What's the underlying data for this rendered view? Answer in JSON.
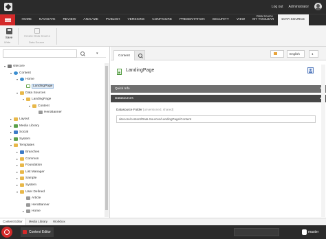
{
  "top": {
    "logout": "Log out",
    "user": "Administrator"
  },
  "ribbon": {
    "context_label": "Data Source",
    "tabs": [
      "HOME",
      "NAVIGATE",
      "REVIEW",
      "ANALYZE",
      "PUBLISH",
      "VERSIONS",
      "CONFIGURE",
      "PRESENTATION",
      "SECURITY",
      "VIEW",
      "MY TOOLBAR",
      "DATA SOURCE"
    ],
    "active_tab": "DATA SOURCE",
    "save_label": "Save",
    "write_group": "Write",
    "create_label_1": "Create Data Source",
    "create_group": "Data Source"
  },
  "tree": {
    "search_placeholder": "",
    "nodes": [
      {
        "label": "sitecore",
        "toggle": "▾",
        "icon": "root",
        "level": 0
      },
      {
        "label": "Content",
        "toggle": "▾",
        "icon": "globe",
        "level": 1
      },
      {
        "label": "Home",
        "toggle": "▾",
        "icon": "globe",
        "level": 2
      },
      {
        "label": "LandingPage",
        "toggle": "",
        "icon": "doc",
        "level": 3,
        "selected": true
      },
      {
        "label": "Data Sources",
        "toggle": "▾",
        "icon": "folder",
        "level": 2
      },
      {
        "label": "LandingPage",
        "toggle": "▾",
        "icon": "folder",
        "level": 3
      },
      {
        "label": "Content",
        "toggle": "▾",
        "icon": "folder",
        "level": 4
      },
      {
        "label": "HeroBanner",
        "toggle": "",
        "icon": "gray",
        "level": 5
      },
      {
        "label": "Layout",
        "toggle": "▸",
        "icon": "folder",
        "level": 1
      },
      {
        "label": "Media Library",
        "toggle": "▸",
        "icon": "green",
        "level": 1
      },
      {
        "label": "Social",
        "toggle": "▸",
        "icon": "blue",
        "level": 1
      },
      {
        "label": "System",
        "toggle": "▸",
        "icon": "green",
        "level": 1
      },
      {
        "label": "Templates",
        "toggle": "▾",
        "icon": "folder",
        "level": 1
      },
      {
        "label": "Branches",
        "toggle": "▸",
        "icon": "blue",
        "level": 2
      },
      {
        "label": "Common",
        "toggle": "▸",
        "icon": "folder",
        "level": 2
      },
      {
        "label": "Foundation",
        "toggle": "▸",
        "icon": "folder",
        "level": 2
      },
      {
        "label": "List Manager",
        "toggle": "▸",
        "icon": "folder",
        "level": 2
      },
      {
        "label": "Sample",
        "toggle": "▸",
        "icon": "folder",
        "level": 2
      },
      {
        "label": "System",
        "toggle": "▸",
        "icon": "folder",
        "level": 2
      },
      {
        "label": "User Defined",
        "toggle": "▾",
        "icon": "folder",
        "level": 2
      },
      {
        "label": "Article",
        "toggle": "",
        "icon": "gray",
        "level": 3
      },
      {
        "label": "HeroBanner",
        "toggle": "",
        "icon": "gray",
        "level": 3
      },
      {
        "label": "Home",
        "toggle": "▸",
        "icon": "gray",
        "level": 3
      }
    ]
  },
  "editor": {
    "tab_content": "Content",
    "language": "English",
    "version": "1",
    "item_title": "LandingPage",
    "section_quick": "Quick Info",
    "section_ds": "Datasources",
    "field_label": "Datasource Folder",
    "field_note": "[unversioned, shared]",
    "field_value": "sitecore/content/Data Sources/LandingPage/Content"
  },
  "bottom_tabs": [
    "Content Editor",
    "Media Library",
    "Workbox"
  ],
  "status": {
    "app": "Content Editor",
    "database": "master"
  }
}
